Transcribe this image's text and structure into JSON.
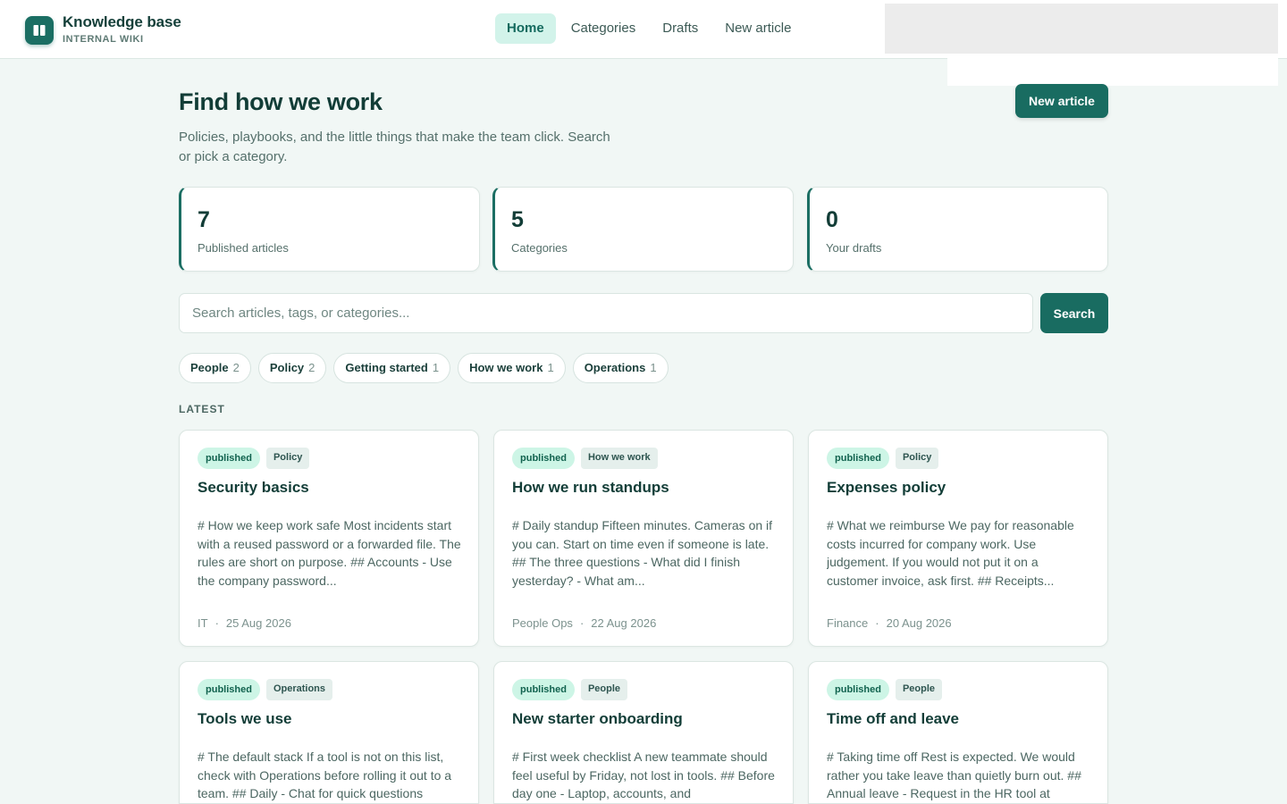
{
  "brand": {
    "title": "Knowledge base",
    "subtitle": "INTERNAL WIKI",
    "logo_icon": "book-icon"
  },
  "nav": {
    "items": [
      {
        "label": "Home",
        "active": true
      },
      {
        "label": "Categories",
        "active": false
      },
      {
        "label": "Drafts",
        "active": false
      },
      {
        "label": "New article",
        "active": false
      }
    ]
  },
  "hero": {
    "title": "Find how we work",
    "description": "Policies, playbooks, and the little things that make the team click. Search or pick a category.",
    "new_article_label": "New article"
  },
  "stats": [
    {
      "value": "7",
      "label": "Published articles"
    },
    {
      "value": "5",
      "label": "Categories"
    },
    {
      "value": "0",
      "label": "Your drafts"
    }
  ],
  "search": {
    "placeholder": "Search articles, tags, or categories...",
    "value": "",
    "button_label": "Search"
  },
  "chips": [
    {
      "label": "People",
      "count": "2"
    },
    {
      "label": "Policy",
      "count": "2"
    },
    {
      "label": "Getting started",
      "count": "1"
    },
    {
      "label": "How we work",
      "count": "1"
    },
    {
      "label": "Operations",
      "count": "1"
    }
  ],
  "latest": {
    "section_label": "LATEST",
    "articles": [
      {
        "status": "published",
        "category": "Policy",
        "title": "Security basics",
        "excerpt": "# How we keep work safe Most incidents start with a reused password or a forwarded file. The rules are short on purpose. ## Accounts - Use the company password...",
        "team": "IT",
        "date": "25 Aug 2026"
      },
      {
        "status": "published",
        "category": "How we work",
        "title": "How we run standups",
        "excerpt": "# Daily standup Fifteen minutes. Cameras on if you can. Start on time even if someone is late. ## The three questions - What did I finish yesterday? - What am...",
        "team": "People Ops",
        "date": "22 Aug 2026"
      },
      {
        "status": "published",
        "category": "Policy",
        "title": "Expenses policy",
        "excerpt": "# What we reimburse We pay for reasonable costs incurred for company work. Use judgement. If you would not put it on a customer invoice, ask first. ## Receipts...",
        "team": "Finance",
        "date": "20 Aug 2026"
      },
      {
        "status": "published",
        "category": "Operations",
        "title": "Tools we use",
        "excerpt": "# The default stack If a tool is not on this list, check with Operations before rolling it out to a team. ## Daily - Chat for quick questions",
        "team": "",
        "date": ""
      },
      {
        "status": "published",
        "category": "People",
        "title": "New starter onboarding",
        "excerpt": "# First week checklist A new teammate should feel useful by Friday, not lost in tools. ## Before day one - Laptop, accounts, and",
        "team": "",
        "date": ""
      },
      {
        "status": "published",
        "category": "People",
        "title": "Time off and leave",
        "excerpt": "# Taking time off Rest is expected. We would rather you take leave than quietly burn out. ## Annual leave - Request in the HR tool at",
        "team": "",
        "date": ""
      }
    ]
  }
}
